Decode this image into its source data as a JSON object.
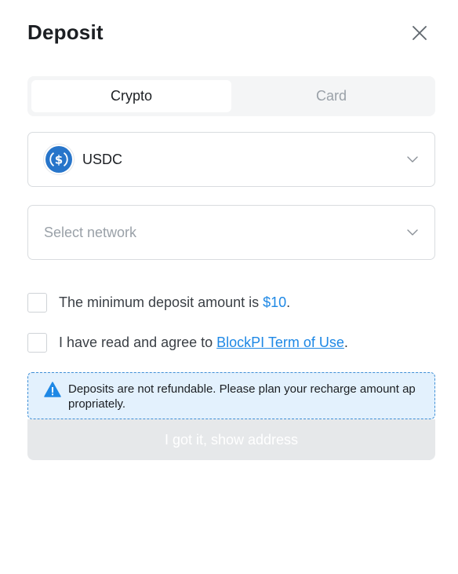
{
  "dialog": {
    "title": "Deposit",
    "close_icon": "close-icon"
  },
  "tabs": [
    {
      "label": "Crypto",
      "active": true
    },
    {
      "label": "Card",
      "active": false
    }
  ],
  "coin_select": {
    "value": "USDC",
    "icon": "usdc-coin-icon",
    "icon_color": "#2775CA"
  },
  "network_select": {
    "placeholder": "Select network"
  },
  "checks": {
    "min_deposit": {
      "text": "The minimum deposit amount is ",
      "amount": "$10",
      "suffix": "."
    },
    "terms": {
      "text": "I have read and agree to ",
      "link": "BlockPI Term of Use",
      "suffix": "."
    }
  },
  "notice": {
    "icon": "warning-icon",
    "text": "Deposits are not refundable. Please plan your recharge amount appropriately."
  },
  "cta": {
    "label": "I got it, show address"
  },
  "colors": {
    "accent": "#1e88e5",
    "notice_bg": "#e3f1fd",
    "notice_border": "#3f8fd6",
    "cta_disabled_bg": "#e6e8ea"
  }
}
